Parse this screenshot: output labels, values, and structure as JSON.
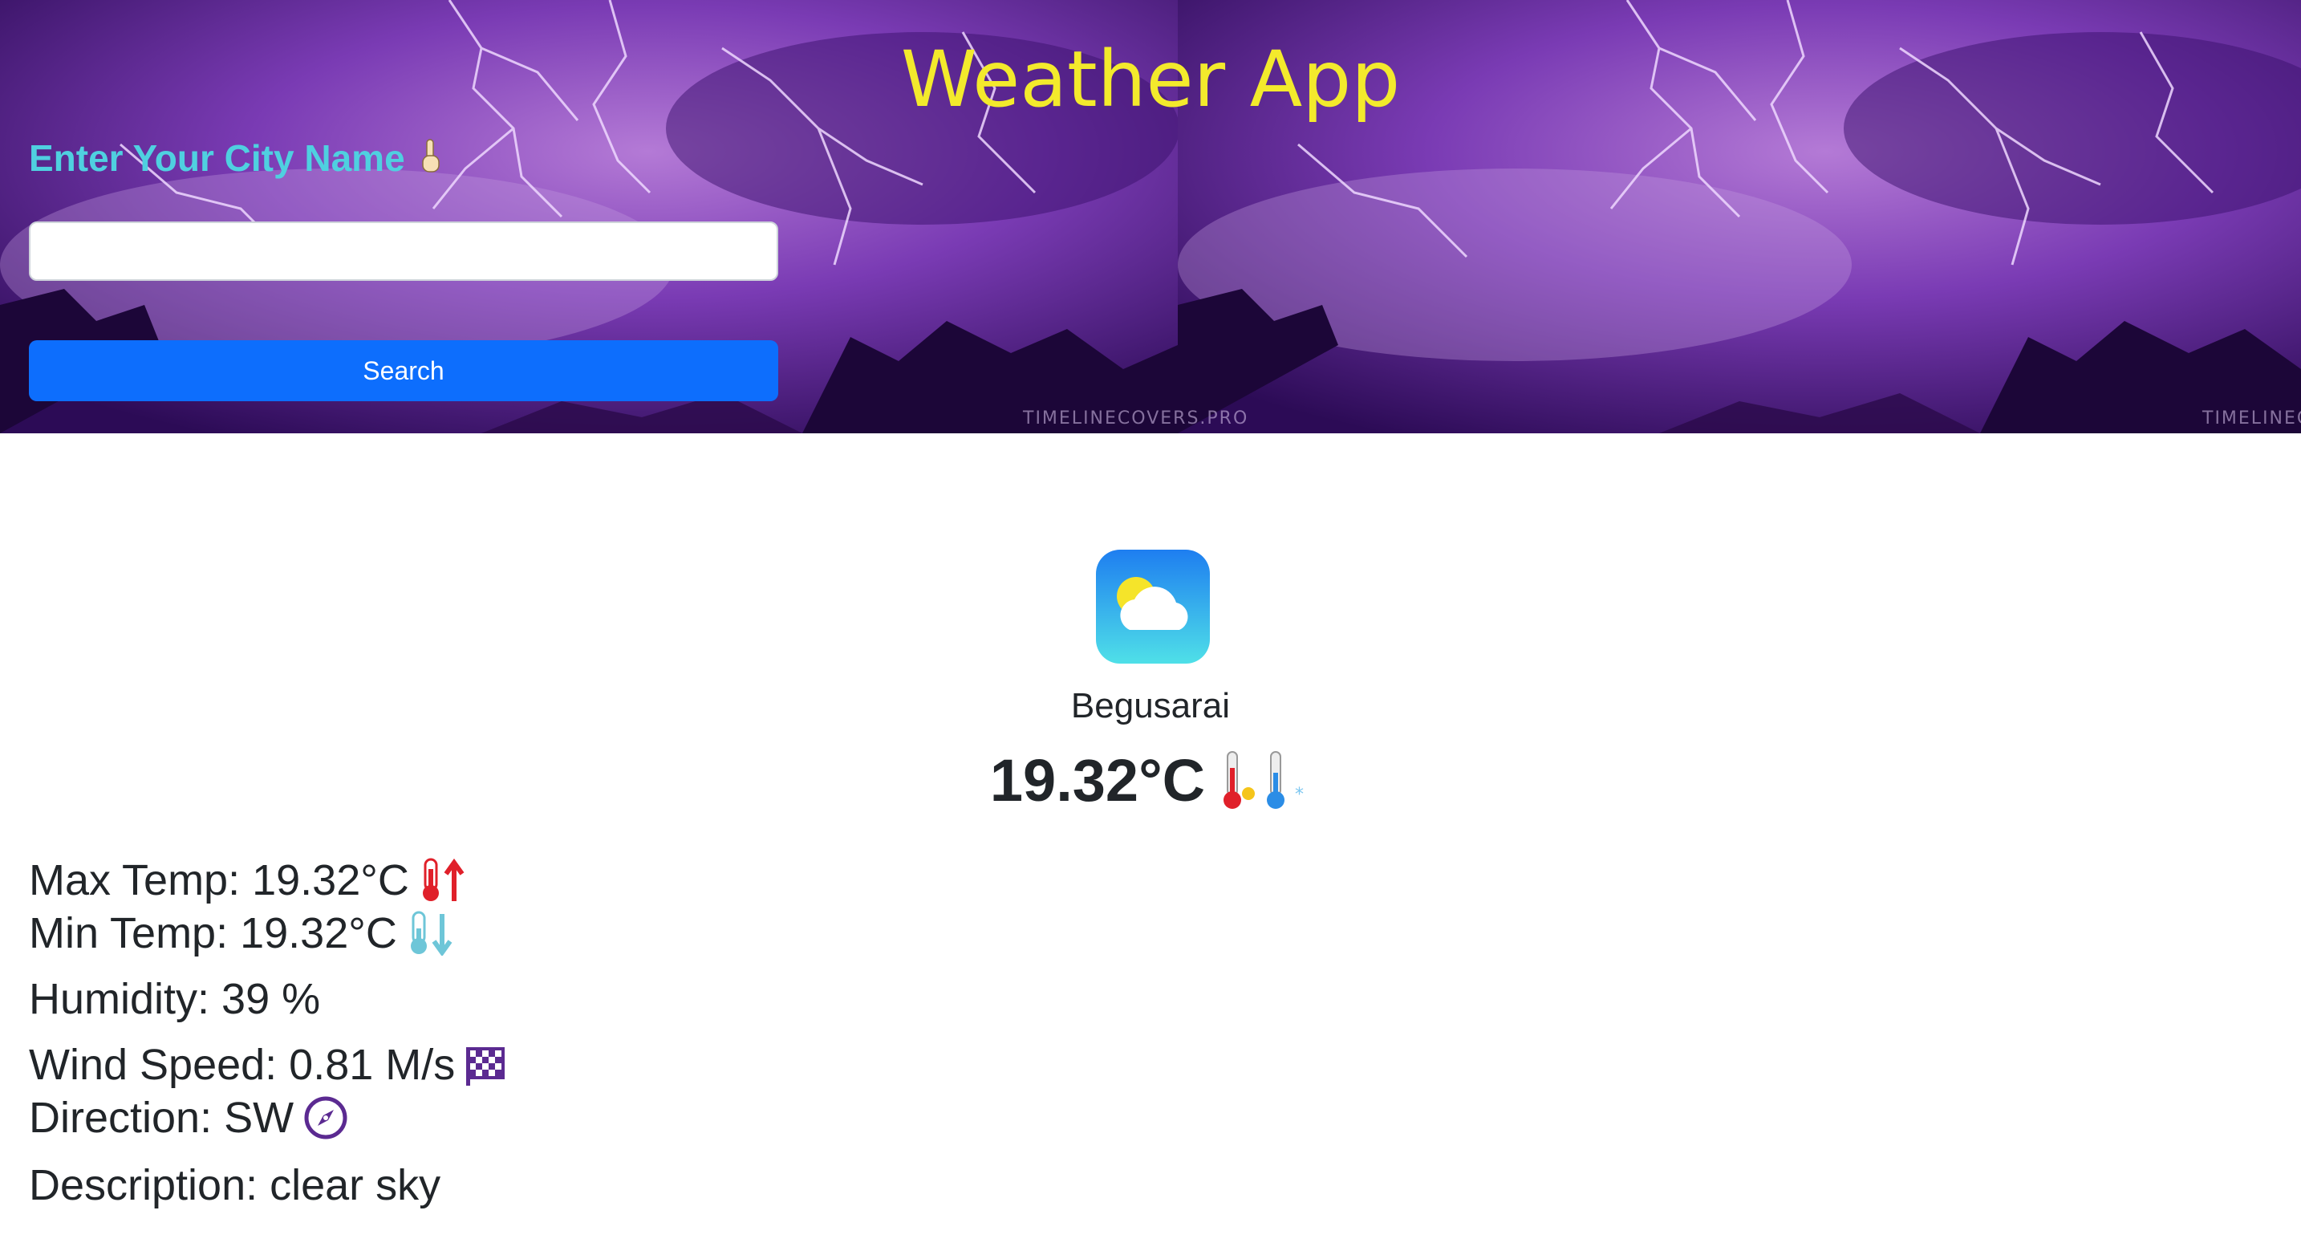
{
  "header": {
    "title": "Weather App",
    "watermark": "TIMELINECOVERS.PRO",
    "watermark_right": "TIMELINECOVE"
  },
  "search": {
    "label": "Enter Your City Name",
    "input_value": "",
    "button_label": "Search"
  },
  "weather": {
    "city": "Begusarai",
    "temperature": "19.32°C",
    "icon": "partly-cloudy-icon"
  },
  "details": {
    "max_temp": "Max Temp: 19.32°C",
    "min_temp": "Min Temp: 19.32°C",
    "humidity": "Humidity: 39 %",
    "wind_speed": "Wind Speed: 0.81 M/s",
    "direction": "Direction: SW",
    "description": "Description: clear sky"
  },
  "icons": {
    "label_pointer": "pointing-down-icon",
    "temp_pair": "thermometer-hot-cold-icon",
    "max": "thermometer-up-arrow-icon",
    "min": "thermometer-down-arrow-icon",
    "wind": "checkered-flag-icon",
    "direction": "compass-icon"
  },
  "colors": {
    "title": "#f3ea2c",
    "label": "#4fd0e0",
    "button": "#0d6efd",
    "accent_purple": "#5b2a91"
  }
}
